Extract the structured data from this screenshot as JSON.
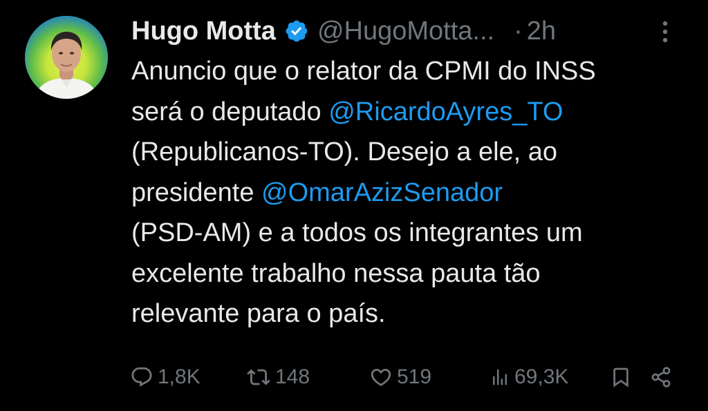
{
  "author": {
    "display_name": "Hugo Motta",
    "handle": "@HugoMotta...",
    "separator": "·",
    "time": "2h"
  },
  "tweet": {
    "lines": [
      [
        {
          "t": "Anuncio que o relator da CPMI do INSS",
          "mention": false
        }
      ],
      [
        {
          "t": "será o deputado ",
          "mention": false
        },
        {
          "t": "@RicardoAyres_TO",
          "mention": true
        }
      ],
      [
        {
          "t": "(Republicanos-TO). Desejo a ele, ao",
          "mention": false
        }
      ],
      [
        {
          "t": "presidente ",
          "mention": false
        },
        {
          "t": "@OmarAzizSenador",
          "mention": true
        }
      ],
      [
        {
          "t": "(PSD-AM) e a todos os integrantes um",
          "mention": false
        }
      ],
      [
        {
          "t": "excelente trabalho nessa pauta tão",
          "mention": false
        }
      ],
      [
        {
          "t": "relevante para o país.",
          "mention": false
        }
      ]
    ]
  },
  "actions": {
    "reply_count": "1,8K",
    "retweet_count": "148",
    "like_count": "519",
    "views_count": "69,3K"
  },
  "icons": {
    "verified": "verified-badge-icon",
    "more": "more-vertical-icon",
    "reply": "reply-icon",
    "retweet": "retweet-icon",
    "like": "heart-icon",
    "views": "views-icon",
    "bookmark": "bookmark-icon",
    "share": "share-icon"
  },
  "colors": {
    "background": "#000000",
    "text": "#e7e9ea",
    "secondary": "#71767b",
    "accent": "#1d9bf0"
  }
}
